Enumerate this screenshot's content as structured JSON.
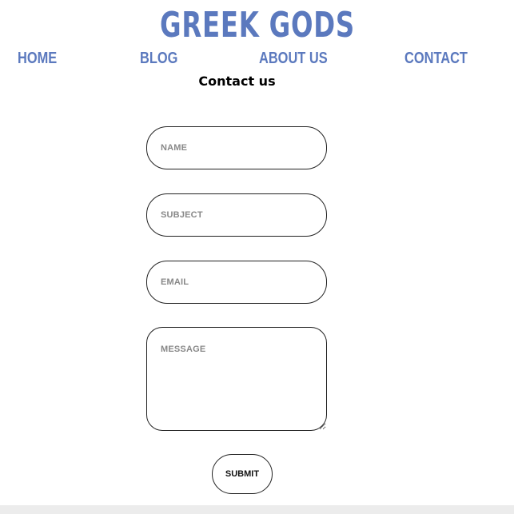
{
  "brand": {
    "logo_text": "GREEK GODS",
    "color": "#5b79be"
  },
  "nav": {
    "items": [
      {
        "label": "HOME"
      },
      {
        "label": "BLOG"
      },
      {
        "label": "ABOUT US"
      },
      {
        "label": "CONTACT"
      }
    ]
  },
  "page": {
    "heading": "Contact us"
  },
  "form": {
    "name_placeholder": "NAME",
    "subject_placeholder": "SUBJECT",
    "email_placeholder": "EMAIL",
    "message_placeholder": "MESSAGE",
    "submit_label": "SUBMIT"
  },
  "icons": {
    "textarea_resize": "resize-handle-icon"
  }
}
